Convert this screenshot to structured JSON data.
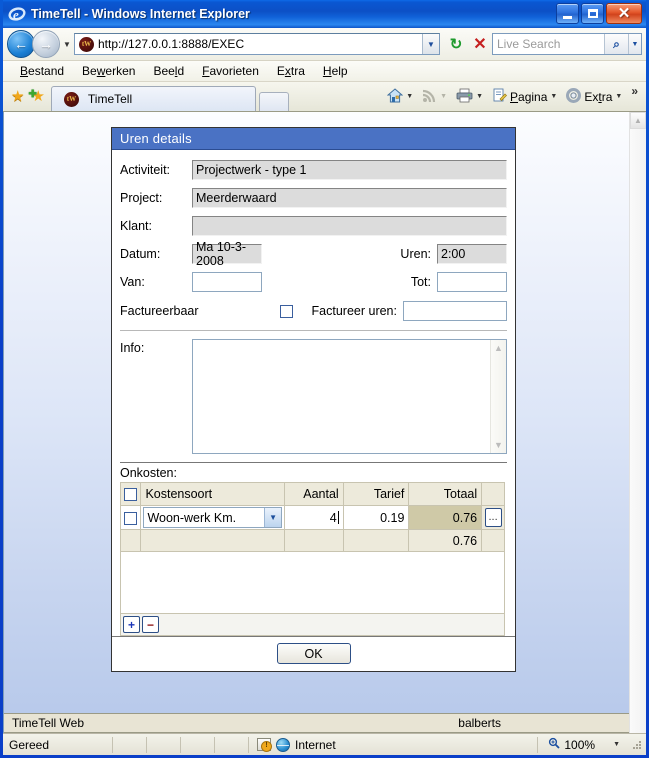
{
  "window": {
    "title": "TimeTell - Windows Internet Explorer",
    "minimize_label": "",
    "maximize_label": "",
    "close_label": "✕"
  },
  "nav": {
    "back_glyph": "←",
    "forward_glyph": "→",
    "history_caret": "▼",
    "url": "http://127.0.0.1:8888/EXEC",
    "favicon_text": "tW",
    "url_dropdown_caret": "▼",
    "refresh_glyph": "↻",
    "stop_glyph": "✕",
    "search_placeholder": "Live Search",
    "search_go_glyph": "⌕",
    "search_caret": "▼"
  },
  "menu": {
    "items": [
      {
        "pre": "",
        "accel": "B",
        "post": "estand"
      },
      {
        "pre": "Be",
        "accel": "w",
        "post": "erken"
      },
      {
        "pre": "Bee",
        "accel": "l",
        "post": "d"
      },
      {
        "pre": "",
        "accel": "F",
        "post": "avorieten"
      },
      {
        "pre": "E",
        "accel": "x",
        "post": "tra"
      },
      {
        "pre": "",
        "accel": "H",
        "post": "elp"
      }
    ]
  },
  "tabbar": {
    "favorites_star": "★",
    "add_favorite_star": "★",
    "add_favorite_plus": "✚",
    "tab_label": "TimeTell",
    "tab_favicon_text": "tW",
    "commands": [
      {
        "name": "home",
        "glyph": "⌂",
        "label": "",
        "caret": "▼",
        "dim": false
      },
      {
        "name": "feeds",
        "glyph": "◔",
        "label": "",
        "caret": "▼",
        "dim": true
      },
      {
        "name": "print",
        "glyph": "⎙",
        "label": "",
        "caret": "▼",
        "dim": false
      },
      {
        "name": "page",
        "glyph": "▤",
        "label": "Pagina",
        "caret": "▼",
        "dim": false
      },
      {
        "name": "tools",
        "glyph": "⚙",
        "label": "Extra",
        "caret": "▼",
        "dim": false
      }
    ],
    "overflow_glyph": "»"
  },
  "dialog": {
    "title": "Uren details",
    "fields": {
      "activiteit_label": "Activiteit:",
      "activiteit_value": "Projectwerk - type 1",
      "project_label": "Project:",
      "project_value": "Meerderwaard",
      "klant_label": "Klant:",
      "klant_value": "",
      "datum_label": "Datum:",
      "datum_value": "Ma 10-3-2008",
      "uren_label": "Uren:",
      "uren_value": "2:00",
      "van_label": "Van:",
      "van_value": "",
      "tot_label": "Tot:",
      "tot_value": "",
      "factureerbaar_label": "Factureerbaar",
      "factureer_uren_label": "Factureer uren:",
      "factureer_uren_value": "",
      "info_label": "Info:",
      "info_value": ""
    },
    "onkosten": {
      "label": "Onkosten:",
      "columns": [
        "",
        "Kostensoort",
        "Aantal",
        "Tarief",
        "Totaal",
        ""
      ],
      "rows": [
        {
          "kostensoort": "Woon-werk Km.",
          "aantal": "4",
          "tarief": "0.19",
          "totaal": "0.76",
          "detail_button": "..."
        }
      ],
      "sum_total": "0.76",
      "add_button": "+",
      "remove_button": "−",
      "select_caret": "▼"
    },
    "ok_button": "OK"
  },
  "page_footer": {
    "left": "TimeTell Web",
    "right": "balberts"
  },
  "statusbar": {
    "status": "Gereed",
    "zone": "Internet",
    "zoom": "100%",
    "zoom_caret": "▼"
  },
  "scrollbar": {
    "up_glyph": "▲",
    "down_glyph": "▼"
  },
  "colors": {
    "title_blue": "#0a3fc8",
    "dialog_header": "#4a72c4",
    "grid_header": "#edeadb",
    "total_cell": "#cfc9a7",
    "plus_blue": "#1a35b8",
    "minus_red": "#8c1111"
  }
}
